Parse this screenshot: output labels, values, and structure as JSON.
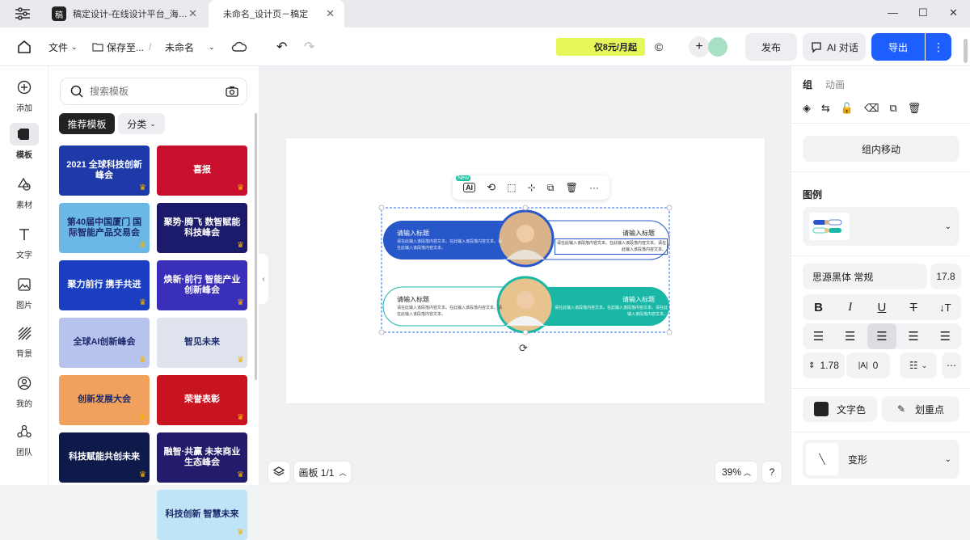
{
  "titlebar": {
    "tab1": "稿定设计-在线设计平台_海…",
    "tab2": "未命名_设计页－稿定",
    "favicon_text": "稿"
  },
  "toolbar": {
    "file": "文件",
    "save_to": "保存至...",
    "sep": "/",
    "doc_name": "未命名",
    "promo": "仅8元/月起",
    "publish": "发布",
    "ai_chat": "AI 对话",
    "export": "导出"
  },
  "rail": [
    {
      "label": "添加",
      "icon": "plus-circle-icon"
    },
    {
      "label": "模板",
      "icon": "template-icon"
    },
    {
      "label": "素材",
      "icon": "shapes-icon"
    },
    {
      "label": "文字",
      "icon": "text-icon"
    },
    {
      "label": "图片",
      "icon": "image-icon"
    },
    {
      "label": "背景",
      "icon": "background-icon"
    },
    {
      "label": "我的",
      "icon": "user-icon"
    },
    {
      "label": "团队",
      "icon": "team-icon"
    }
  ],
  "panel": {
    "search_placeholder": "搜索模板",
    "tab_recommend": "推荐模板",
    "tab_category": "分类",
    "templates_left": [
      {
        "text": "2021 全球科技创新峰会",
        "color": "#1d3aa8"
      },
      {
        "text": "第40届中国厦门 国际智能产品交易会",
        "color": "#6bb8e6"
      },
      {
        "text": "聚力前行 携手共进",
        "color": "#1b3fc0"
      },
      {
        "text": "全球AI创新峰会",
        "color": "#b8c3ee"
      },
      {
        "text": "创新发展大会",
        "color": "#f1a15c"
      },
      {
        "text": "科技赋能共创未来",
        "color": "#101a4a"
      }
    ],
    "templates_right": [
      {
        "text": "喜报",
        "color": "#c8102e"
      },
      {
        "text": "聚势·腾飞 数智赋能科技峰会",
        "color": "#1b1a6b"
      },
      {
        "text": "焕新·前行 智能产业创新峰会",
        "color": "#3a2fb8"
      },
      {
        "text": "智见未来",
        "color": "#dfe3ee"
      },
      {
        "text": "荣誉表彰",
        "color": "#c81421"
      },
      {
        "text": "融智·共赢 未来商业生态峰会",
        "color": "#231b6b"
      },
      {
        "text": "科技创新 智慧未来",
        "color": "#bfe3f7"
      }
    ]
  },
  "canvas": {
    "item_title": "请输入标题",
    "item_body": "请在此输入该段落内容文本。在此输入该段落内容文本。请在此输入该段落内容文本。",
    "new_badge": "New",
    "board": "画板 1/1",
    "zoom": "39%",
    "help": "?"
  },
  "rpanel": {
    "tab_group": "组",
    "tab_anim": "动画",
    "group_move": "组内移动",
    "legend": "图例",
    "font": "思源黑体 常规",
    "font_size": "17.8",
    "line_height": "1.78",
    "letter_spacing": "0",
    "text_color": "文字色",
    "highlight": "划重点",
    "transform": "变形"
  },
  "colors": {
    "accent": "#1e5eff",
    "infographic_blue": "#2757c9",
    "infographic_teal": "#1bb7a6"
  }
}
